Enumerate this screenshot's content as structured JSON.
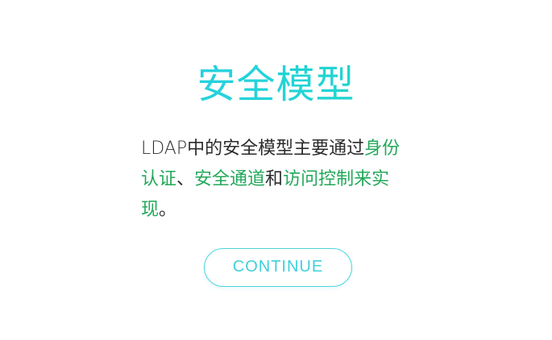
{
  "title": "安全模型",
  "description": {
    "part1": "LDAP中的安全模型主要通过",
    "term1": "身份认证",
    "sep1": "、",
    "term2": "安全通道",
    "conj": "和",
    "term3": "访问控制",
    "part2": "来",
    "term4": "实现",
    "end": "。"
  },
  "button": {
    "label": "CONTINUE"
  },
  "colors": {
    "title_gradient_start": "#34c7ec",
    "title_gradient_end": "#27d6b6",
    "highlight": "#22a85a",
    "button_accent": "#4cd6dc",
    "body_text": "#2b2b2b"
  }
}
